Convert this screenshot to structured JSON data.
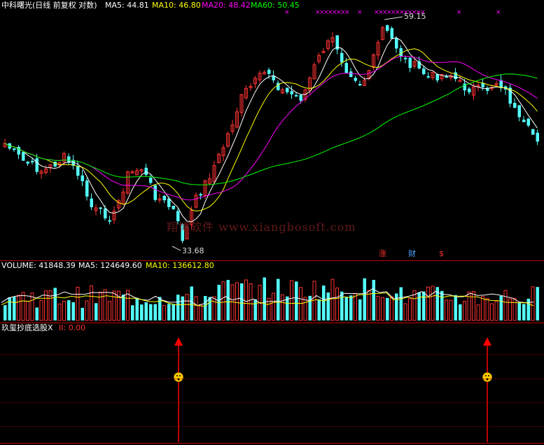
{
  "main_panel": {
    "title": "中科曙光(日线 前复权 对数)",
    "ma": [
      {
        "label": "MA5: 44.81",
        "color": "#ffffff"
      },
      {
        "label": "MA10: 46.80",
        "color": "#ffff00"
      },
      {
        "label": "MA20: 48.42",
        "color": "#ff00ff"
      },
      {
        "label": "MA60: 50.45",
        "color": "#00ff00"
      }
    ],
    "high_marker": "59.15",
    "low_marker": "33.68",
    "watermark": "翔博软件 www.xiangbosoft.com",
    "event_badges": [
      {
        "label": "涨",
        "color": "#ff3030"
      },
      {
        "label": "财",
        "color": "#4fa3ff"
      },
      {
        "label": "$",
        "color": "#ff3030"
      }
    ]
  },
  "volume_panel": {
    "title": "VOLUME: 41848.39",
    "ma5": "MA5: 124649.60",
    "ma10": "MA10: 136612.80"
  },
  "indicator_panel": {
    "title": "玖玺抄底选股X",
    "value_label": "II: 0.00",
    "signals": [
      "buy-signal-1",
      "buy-signal-2"
    ]
  },
  "colors": {
    "up": "#ff3232",
    "down": "#54ffff",
    "ma5": "#ffffff",
    "ma10": "#ffff00",
    "ma20": "#ff00ff",
    "ma60": "#00ff00",
    "signal": "#ff0000",
    "separator": "#c00000"
  }
}
